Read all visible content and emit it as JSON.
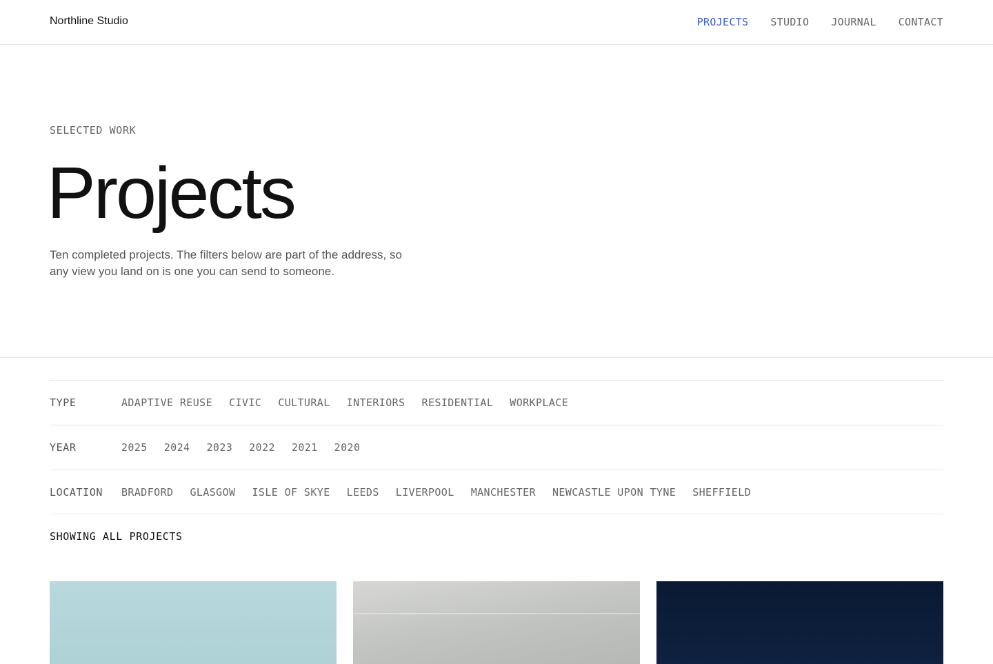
{
  "header": {
    "brand": "Northline Studio",
    "nav": [
      {
        "label": "PROJECTS",
        "active": true
      },
      {
        "label": "STUDIO",
        "active": false
      },
      {
        "label": "JOURNAL",
        "active": false
      },
      {
        "label": "CONTACT",
        "active": false
      }
    ]
  },
  "hero": {
    "eyebrow": "SELECTED WORK",
    "title": "Projects",
    "description": "Ten completed projects. The filters below are part of the address, so any view you land on is one you can send to someone."
  },
  "filters": {
    "type": {
      "label": "TYPE",
      "options": [
        "ADAPTIVE REUSE",
        "CIVIC",
        "CULTURAL",
        "INTERIORS",
        "RESIDENTIAL",
        "WORKPLACE"
      ]
    },
    "year": {
      "label": "YEAR",
      "options": [
        "2025",
        "2024",
        "2023",
        "2022",
        "2021",
        "2020"
      ]
    },
    "location": {
      "label": "LOCATION",
      "options": [
        "BRADFORD",
        "GLASGOW",
        "ISLE OF SKYE",
        "LEEDS",
        "LIVERPOOL",
        "MANCHESTER",
        "NEWCASTLE UPON TYNE",
        "SHEFFIELD"
      ]
    }
  },
  "status": "SHOWING ALL PROJECTS",
  "colors": {
    "accent": "#3b5bdb",
    "text": "#111111",
    "muted": "#666666",
    "rule": "#e6e6e6"
  }
}
